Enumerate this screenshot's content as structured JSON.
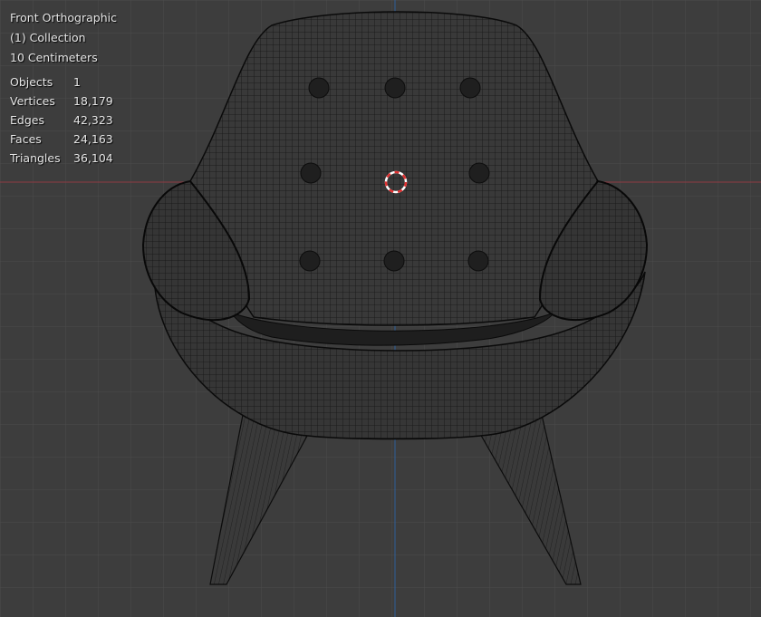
{
  "viewport": {
    "view_name": "Front Orthographic",
    "collection": "(1) Collection",
    "grid_scale": "10 Centimeters"
  },
  "stats": [
    {
      "label": "Objects",
      "value": "1"
    },
    {
      "label": "Vertices",
      "value": "18,179"
    },
    {
      "label": "Edges",
      "value": "42,323"
    },
    {
      "label": "Faces",
      "value": "24,163"
    },
    {
      "label": "Triangles",
      "value": "36,104"
    }
  ],
  "colors": {
    "background": "#3d3d3d",
    "grid_line": "#4a4a4a",
    "x_axis": "#8f3a44",
    "z_axis": "#2f5f99",
    "wire": "#111111",
    "cursor_red": "#e03030",
    "cursor_white": "#ffffff"
  }
}
